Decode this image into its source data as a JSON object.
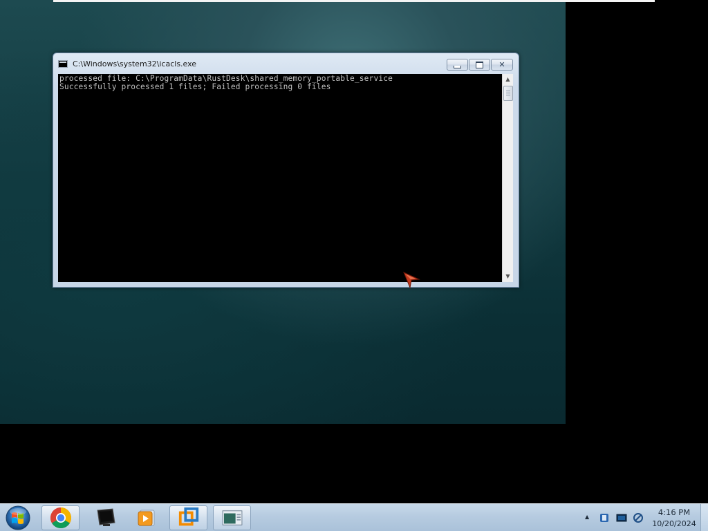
{
  "window": {
    "title": "C:\\Windows\\system32\\icacls.exe",
    "icon": "console-icon",
    "buttons": {
      "minimize": "minimize-icon",
      "maximize": "maximize-icon",
      "close": "close-icon"
    }
  },
  "console": {
    "lines": [
      "processed file: C:\\ProgramData\\RustDesk\\shared_memory_portable_service",
      "Successfully processed 1 files; Failed processing 0 files"
    ],
    "text_color": "#c0c0c0",
    "background_color": "#000000"
  },
  "taskbar": {
    "start": "windows-start-icon",
    "items": [
      {
        "name": "chrome",
        "icon": "chrome-icon",
        "active": true
      },
      {
        "name": "monitor",
        "icon": "monitor-icon",
        "active": false
      },
      {
        "name": "media-player",
        "icon": "media-player-icon",
        "active": false
      },
      {
        "name": "vmware",
        "icon": "vmware-icon",
        "active": true
      },
      {
        "name": "console",
        "icon": "console-window-icon",
        "active": true
      }
    ],
    "tray": {
      "icons": [
        "show-hidden-icons-arrow",
        "network-shield-icon",
        "display-icon",
        "connection-icon"
      ],
      "time": "4:16 PM",
      "date": "10/20/2024"
    }
  }
}
